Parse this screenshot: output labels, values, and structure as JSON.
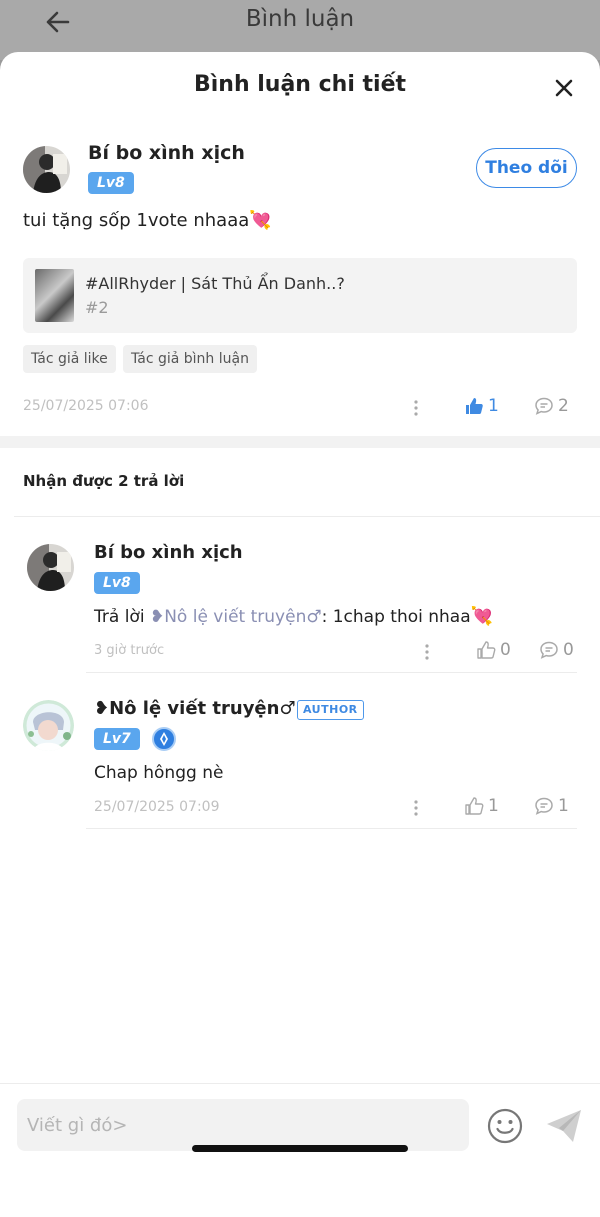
{
  "background_page": {
    "title": "Bình luận"
  },
  "sheet": {
    "title": "Bình luận chi tiết"
  },
  "main_comment": {
    "user": "Bí bo xình xịch",
    "level": "Lv8",
    "follow_label": "Theo dõi",
    "text": "tui tặng sốp 1vote nhaaa",
    "text_emoji": "💘",
    "story": {
      "title": "#AllRhyder | Sát Thủ Ẩn Danh..?",
      "chapter": "#2"
    },
    "tags": [
      "Tác giả like",
      "Tác giả bình luận"
    ],
    "time": "25/07/2025 07:06",
    "likes": "1",
    "comments": "2"
  },
  "replies_header": "Nhận được 2 trả lời",
  "replies": [
    {
      "user": "Bí bo xình xịch",
      "level": "Lv8",
      "reply_prefix": "Trả lời ",
      "mention": "❥Nô lệ viết truyện♂",
      "text": ": 1chap thoi nhaa",
      "text_emoji": "💘",
      "time": "3 giờ trước",
      "likes": "0",
      "comments": "0"
    },
    {
      "user": "❥Nô lệ viết truyện♂",
      "badge": "AUTHOR",
      "level": "Lv7",
      "text": "Chap hôngg nè",
      "time": "25/07/2025 07:09",
      "likes": "1",
      "comments": "1"
    }
  ],
  "input": {
    "placeholder": "Viết gì đó>"
  },
  "colors": {
    "accent": "#3f8ae2",
    "level_badge": "#5aa6ee",
    "heart": "#e8437b"
  }
}
